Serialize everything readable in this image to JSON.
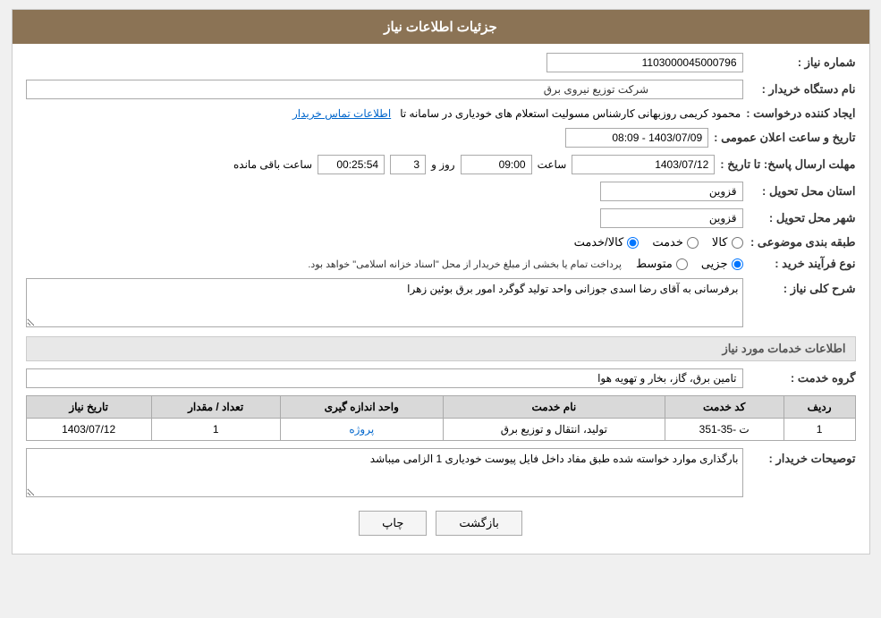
{
  "page": {
    "title": "جزئیات اطلاعات نیاز",
    "header": {
      "bg_color": "#8B7355"
    }
  },
  "fields": {
    "request_number_label": "شماره نیاز :",
    "request_number_value": "1103000045000796",
    "buyer_org_label": "نام دستگاه خریدار :",
    "buyer_org_value": "شرکت توزیع نیروی برق",
    "creator_label": "ایجاد کننده درخواست :",
    "creator_value": "محمود کریمی روزبهانی کارشناس  مسولیت استعلام های خودیاری در سامانه تا",
    "creator_link": "اطلاعات تماس خریدار",
    "announcement_label": "تاریخ و ساعت اعلان عمومی :",
    "announcement_value": "1403/07/09 - 08:09",
    "deadline_label": "مهلت ارسال پاسخ: تا تاریخ :",
    "deadline_date": "1403/07/12",
    "deadline_time_label": "ساعت",
    "deadline_time": "09:00",
    "deadline_days_label": "روز و",
    "deadline_days": "3",
    "countdown_label": "ساعت باقی مانده",
    "countdown_value": "00:25:54",
    "province_label": "استان محل تحویل :",
    "province_value": "قزوین",
    "city_label": "شهر محل تحویل :",
    "city_value": "قزوین",
    "category_label": "طبقه بندی موضوعی :",
    "category_kala": "کالا",
    "category_khedmat": "خدمت",
    "category_kala_khedmat": "کالا/خدمت",
    "purchase_type_label": "نوع فرآیند خرید :",
    "purchase_jozei": "جزیی",
    "purchase_motaset": "متوسط",
    "purchase_note": "پرداخت تمام یا بخشی از مبلغ خریدار از محل \"اسناد خزانه اسلامی\" خواهد بود.",
    "description_label": "شرح کلی نیاز :",
    "description_value": "برفرسانی به آقای رضا اسدی جوزانی واحد تولید گوگرد امور برق بوئین زهرا",
    "services_title": "اطلاعات خدمات مورد نیاز",
    "service_group_label": "گروه خدمت :",
    "service_group_value": "تامین برق، گاز، بخار و تهویه هوا",
    "table": {
      "headers": [
        "ردیف",
        "کد خدمت",
        "نام خدمت",
        "واحد اندازه گیری",
        "تعداد / مقدار",
        "تاریخ نیاز"
      ],
      "rows": [
        {
          "row_num": "1",
          "service_code": "ت -35-351",
          "service_name": "تولید، انتقال و توزیع برق",
          "unit": "پروژه",
          "quantity": "1",
          "date": "1403/07/12"
        }
      ]
    },
    "buyer_desc_label": "توصیحات خریدار :",
    "buyer_desc_value": "بارگذاری موارد خواسته شده طبق مفاد داخل فایل پیوست خودیاری 1 الزامی میباشد",
    "btn_print": "چاپ",
    "btn_back": "بازگشت"
  }
}
